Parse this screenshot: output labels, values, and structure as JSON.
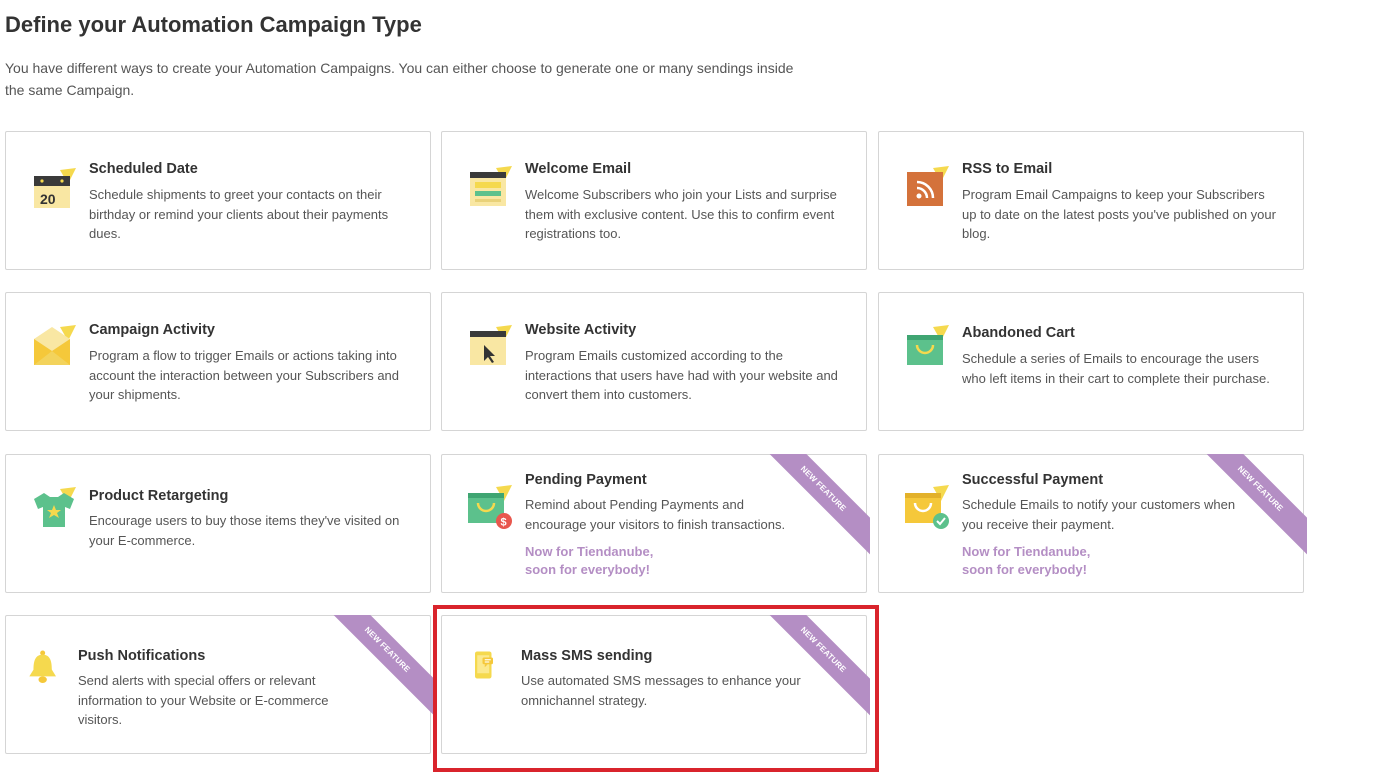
{
  "header": {
    "title": "Define your Automation Campaign Type",
    "intro_line1": "You have different ways to create your Automation Campaigns. You can either choose to generate one or many sendings inside",
    "intro_line2": "the same Campaign."
  },
  "ribbon_label": "NEW FEATURE",
  "cards": {
    "scheduled_date": {
      "title": "Scheduled Date",
      "description": "Schedule shipments to greet your contacts on their birthday or remind your clients about their payments dues.",
      "icon": "calendar-icon",
      "icon_text": "20"
    },
    "welcome_email": {
      "title": "Welcome Email",
      "description": "Welcome Subscribers who join your Lists and surprise them with exclusive content. Use this to confirm event registrations too.",
      "icon": "welcome-browser-icon"
    },
    "rss_to_email": {
      "title": "RSS to Email",
      "description": "Program Email Campaigns to keep your Subscribers up to date on the latest posts you've published on your blog.",
      "icon": "rss-icon"
    },
    "campaign_activity": {
      "title": "Campaign Activity",
      "description": "Program a flow to trigger Emails or actions taking into account the interaction between your Subscribers and your shipments.",
      "icon": "envelope-icon"
    },
    "website_activity": {
      "title": "Website Activity",
      "description": "Program Emails customized according to the interactions that users have had with your website and convert them into customers.",
      "icon": "browser-cursor-icon"
    },
    "abandoned_cart": {
      "title": "Abandoned Cart",
      "description": "Schedule a series of Emails to encourage the users who left items in their cart to complete their purchase.",
      "icon": "shopping-bag-icon"
    },
    "product_retargeting": {
      "title": "Product Retargeting",
      "description": "Encourage users to buy those items they've visited on your E-commerce.",
      "icon": "tshirt-icon"
    },
    "pending_payment": {
      "title": "Pending Payment",
      "description": "Remind about Pending Payments and encourage your visitors to finish transactions.",
      "note_line1": "Now for Tiendanube,",
      "note_line2": "soon for everybody!",
      "icon": "bag-dollar-icon",
      "icon_text": "$"
    },
    "successful_payment": {
      "title": "Successful Payment",
      "description": "Schedule Emails to notify your customers when you receive their payment.",
      "note_line1": "Now for Tiendanube,",
      "note_line2": "soon for everybody!",
      "icon": "bag-check-icon"
    },
    "push_notifications": {
      "title": "Push Notifications",
      "description": "Send alerts with special offers or relevant information to your Website or E-commerce visitors.",
      "icon": "bell-icon"
    },
    "mass_sms": {
      "title": "Mass SMS sending",
      "description": "Use automated SMS messages to enhance your omnichannel strategy.",
      "icon": "mobile-sms-icon"
    }
  },
  "colors": {
    "ribbon": "#b48ec4",
    "highlight": "#d9242c",
    "border": "#d5d5d5",
    "icon_yellow": "#f5d94e",
    "icon_green": "#5cc18c",
    "icon_orange": "#d4723b"
  }
}
